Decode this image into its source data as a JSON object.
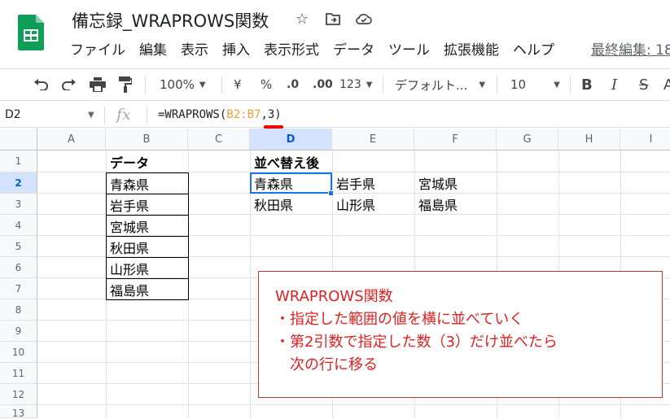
{
  "header": {
    "doc_title": "備忘録_WRAPROWS関数",
    "icons": [
      "star-icon",
      "move-to-folder-icon",
      "cloud-status-icon"
    ],
    "menu": [
      "ファイル",
      "編集",
      "表示",
      "挿入",
      "表示形式",
      "データ",
      "ツール",
      "拡張機能",
      "ヘルプ"
    ],
    "last_edit": "最終編集: 18"
  },
  "toolbar": {
    "zoom": "100%",
    "currency": "¥",
    "percent": "%",
    "decrease_decimal": ".0",
    "increase_decimal": ".00",
    "number_format": "123",
    "font": "デフォルト...",
    "font_size": "10",
    "bold": "B",
    "italic": "I",
    "strike": "S",
    "text_color": "A"
  },
  "formula_bar": {
    "name_box": "D2",
    "fx": "fx",
    "formula_prefix": "=WRAPROWS(",
    "formula_range": "B2:B7",
    "formula_suffix": ",3)"
  },
  "grid": {
    "columns": [
      "A",
      "B",
      "C",
      "D",
      "E",
      "F",
      "G",
      "H",
      "I"
    ],
    "rows": [
      "1",
      "2",
      "3",
      "4",
      "5",
      "6",
      "7",
      "8",
      "9",
      "10",
      "11",
      "12",
      "13"
    ],
    "selected_column": "D",
    "selected_row": "2",
    "data_header": "データ",
    "data_values": [
      "青森県",
      "岩手県",
      "宮城県",
      "秋田県",
      "山形県",
      "福島県"
    ],
    "result_header": "並べ替え後",
    "result_rows": [
      [
        "青森県",
        "岩手県",
        "宮城県"
      ],
      [
        "秋田県",
        "山形県",
        "福島県"
      ]
    ]
  },
  "note": {
    "line1": "WRAPROWS関数",
    "line2": "・指定した範囲の値を横に並べていく",
    "line3": "・第2引数で指定した数（3）だけ並べたら",
    "line4": "次の行に移る"
  },
  "colors": {
    "accent": "#1a73e8",
    "note_text": "#e02020",
    "range_highlight": "#e8a03a"
  }
}
